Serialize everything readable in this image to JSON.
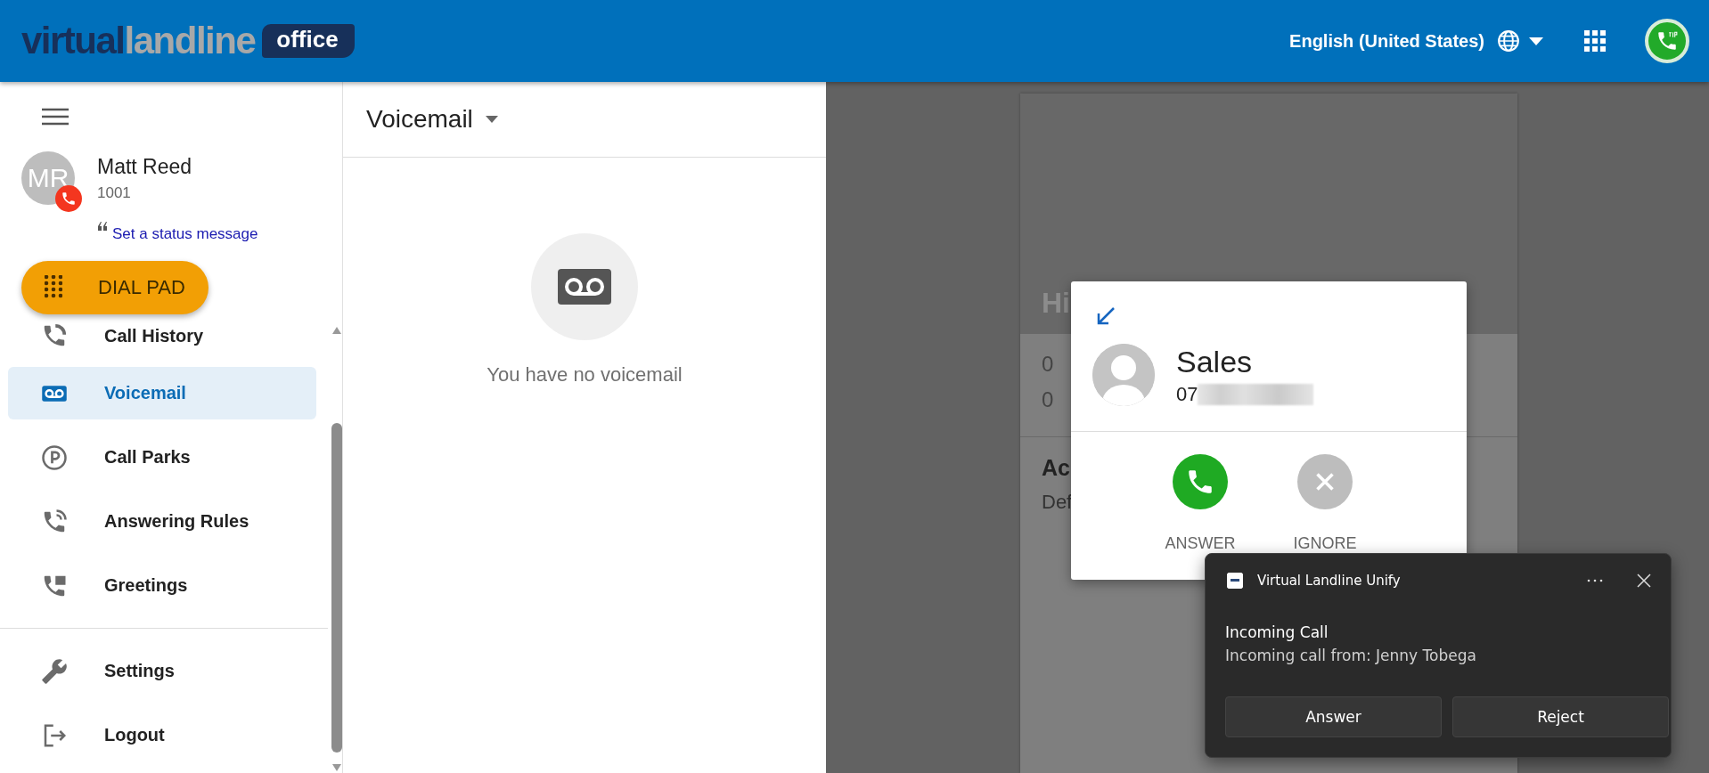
{
  "header": {
    "logo": {
      "part_1": "virtual",
      "part_2": "landline",
      "tag": "office"
    },
    "language": "English (United States)"
  },
  "sidebar": {
    "user": {
      "initials": "MR",
      "name": "Matt Reed",
      "extension": "1001",
      "status_link": "Set a status message"
    },
    "dial_pad": "DIAL PAD",
    "nav": [
      {
        "label": "Call History",
        "kind": "history",
        "selected": false
      },
      {
        "label": "Voicemail",
        "kind": "voicemail",
        "selected": true
      },
      {
        "label": "Call Parks",
        "kind": "park",
        "selected": false
      },
      {
        "label": "Answering Rules",
        "kind": "rules",
        "selected": false
      },
      {
        "label": "Greetings",
        "kind": "greetings",
        "selected": false
      }
    ],
    "footer_nav": [
      {
        "label": "Settings",
        "kind": "settings",
        "selected": false
      },
      {
        "label": "Logout",
        "kind": "logout",
        "selected": false
      }
    ]
  },
  "voicemail_panel": {
    "title": "Voicemail",
    "empty_message": "You have no voicemail"
  },
  "background_card": {
    "heading": "Hi",
    "line_1": "0",
    "line_2": "0",
    "section_title": "Ac",
    "section_text": "Def"
  },
  "incoming_call": {
    "caller": "Sales",
    "number": "07",
    "actions": [
      {
        "label": "ANSWER",
        "kind": "answer"
      },
      {
        "label": "IGNORE",
        "kind": "ignore"
      }
    ]
  },
  "notification": {
    "app": "Virtual Landline Unify",
    "title": "Incoming Call",
    "message": "Incoming call from: Jenny Tobega",
    "buttons": [
      "Answer",
      "Reject"
    ]
  }
}
